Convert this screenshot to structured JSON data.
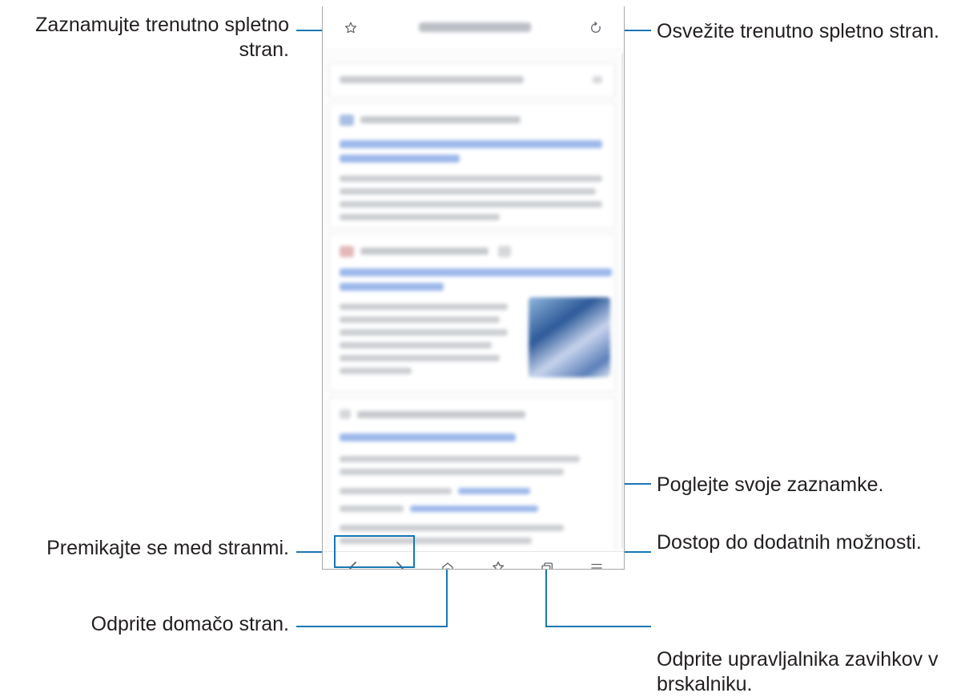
{
  "callouts": {
    "bookmark_current": "Zaznamujte trenutno spletno stran.",
    "refresh": "Osvežite trenutno spletno stran.",
    "view_bookmarks": "Poglejte svoje zaznamke.",
    "navigate": "Premikajte se med stranmi.",
    "more_options": "Dostop do dodatnih možnosti.",
    "home": "Odprite domačo stran.",
    "tabs_manager": "Odprite upravljalnika zavihkov v brskalniku."
  },
  "colors": {
    "callout_line": "#1a76b4",
    "icon": "#5f6368"
  },
  "icons": {
    "bookmark": "star-outline-icon",
    "refresh": "refresh-icon",
    "back": "chevron-left-icon",
    "forward": "chevron-right-icon",
    "home": "home-icon",
    "bookmarks": "star-list-icon",
    "tabs": "tabs-icon",
    "menu": "hamburger-menu-icon"
  }
}
